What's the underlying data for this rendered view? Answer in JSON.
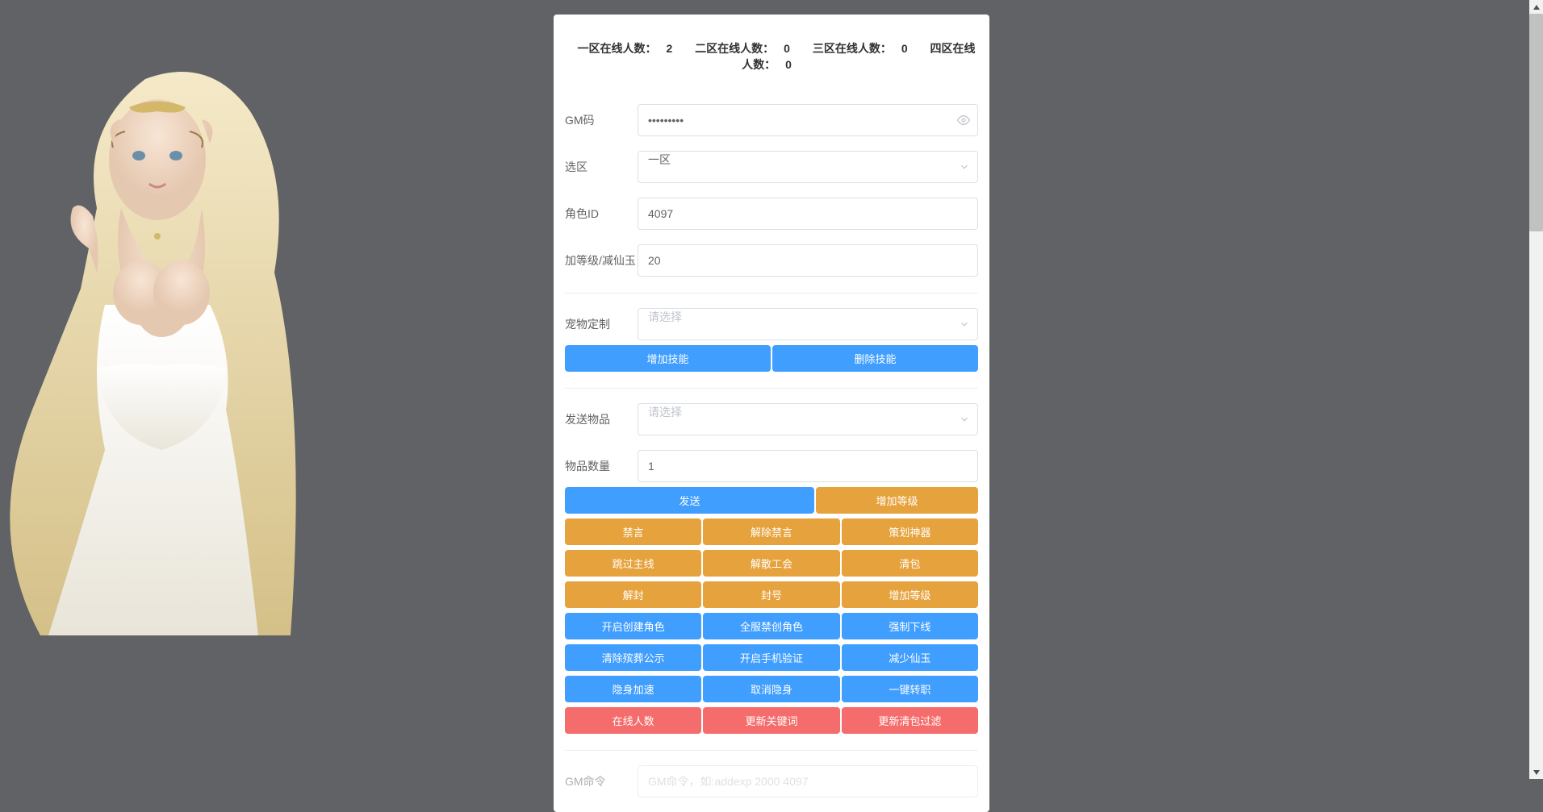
{
  "online": {
    "zone1_label": "一区在线人数：",
    "zone1_count": "2",
    "zone2_label": "二区在线人数：",
    "zone2_count": "0",
    "zone3_label": "三区在线人数：",
    "zone3_count": "0",
    "zone4_label": "四区在线人数：",
    "zone4_count": "0"
  },
  "fields": {
    "gm_code_label": "GM码",
    "gm_code_value": "•••••••••",
    "zone_label": "选区",
    "zone_value": "一区",
    "role_id_label": "角色ID",
    "role_id_value": "4097",
    "level_label": "加等级/减仙玉",
    "level_value": "20",
    "pet_label": "宠物定制",
    "pet_placeholder": "请选择",
    "send_item_label": "发送物品",
    "send_item_placeholder": "请选择",
    "item_qty_label": "物品数量",
    "item_qty_value": "1",
    "gm_cmd_label": "GM命令",
    "gm_cmd_placeholder": "GM命令，如:addexp 2000 4097"
  },
  "buttons": {
    "add_skill": "增加技能",
    "del_skill": "删除技能",
    "send": "发送",
    "add_level": "增加等级",
    "mute": "禁言",
    "unmute": "解除禁言",
    "artifact": "策划神器",
    "skip_main": "跳过主线",
    "disband_guild": "解散工会",
    "clear_bag": "清包",
    "unseal": "解封",
    "seal": "封号",
    "add_level2": "增加等级",
    "enable_create": "开启创建角色",
    "global_ban_create": "全服禁创角色",
    "force_offline": "强制下线",
    "clear_announce": "清除殡葬公示",
    "enable_phone": "开启手机验证",
    "sub_xianyu": "减少仙玉",
    "hide_speed": "隐身加速",
    "cancel_hide": "取消隐身",
    "transfer_job": "一键转职",
    "online_count": "在线人数",
    "update_keyword": "更新关键词",
    "update_clear_filter": "更新清包过滤"
  }
}
